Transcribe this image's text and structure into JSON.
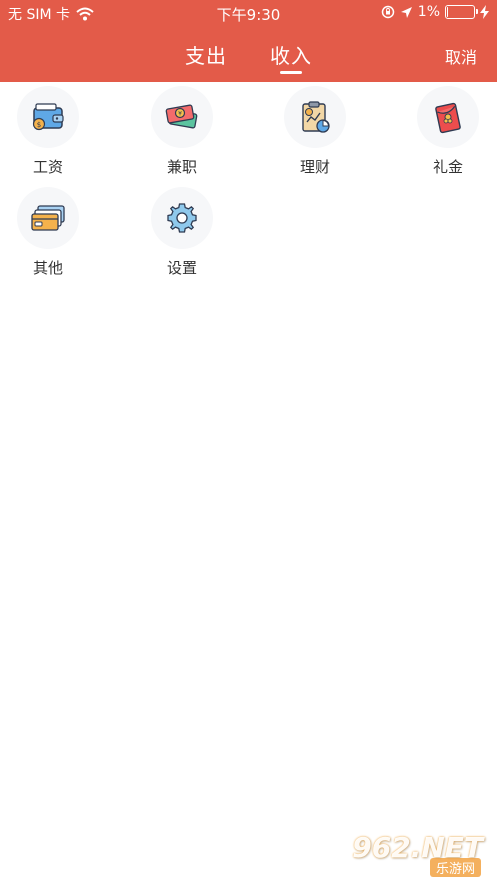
{
  "status_bar": {
    "carrier": "无 SIM 卡",
    "time": "下午9:30",
    "battery": "1%",
    "battery_level": 0.01
  },
  "header": {
    "tabs": [
      {
        "label": "支出",
        "active": false
      },
      {
        "label": "收入",
        "active": true
      }
    ],
    "cancel_label": "取消"
  },
  "categories": [
    {
      "label": "工资",
      "icon": "wallet-icon"
    },
    {
      "label": "兼职",
      "icon": "cash-icon"
    },
    {
      "label": "理财",
      "icon": "finance-clipboard-icon"
    },
    {
      "label": "礼金",
      "icon": "red-envelope-icon"
    },
    {
      "label": "其他",
      "icon": "cards-icon"
    },
    {
      "label": "设置",
      "icon": "gear-icon"
    }
  ],
  "watermark": {
    "number": "962.NET",
    "text": "乐游网"
  },
  "colors": {
    "accent": "#e35b49",
    "icon_bg": "#f6f7f9",
    "label": "#333333"
  }
}
